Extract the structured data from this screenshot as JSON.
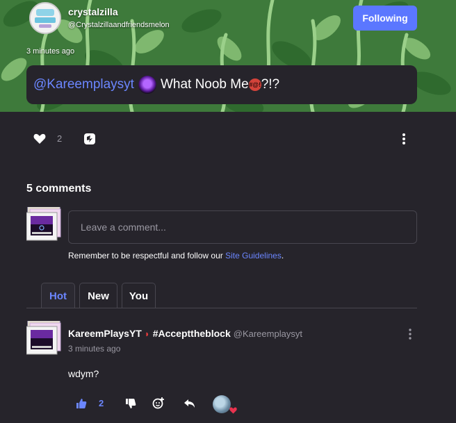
{
  "post": {
    "username": "crystalzilla",
    "handle": "@Crystalzillaandfriendsmelon",
    "time": "3 minutes ago",
    "follow_label": "Following",
    "mention": "@Kareemplaysyt",
    "message": "What Noob Me",
    "message_suffix": "?!?",
    "like_count": "2"
  },
  "comments": {
    "title": "5 comments",
    "placeholder": "Leave a comment...",
    "guidelines_prefix": "Remember to be respectful and follow our ",
    "guidelines_link": "Site Guidelines",
    "guidelines_suffix": ".",
    "tabs": [
      {
        "label": "Hot",
        "active": true
      },
      {
        "label": "New",
        "active": false
      },
      {
        "label": "You",
        "active": false
      }
    ],
    "items": [
      {
        "name": "KareemPlaysYT",
        "tag": "#Accepttheblock",
        "handle": "@Kareemplaysyt",
        "time": "3 minutes ago",
        "text": "wdym?",
        "like_count": "2"
      }
    ]
  },
  "colors": {
    "accent": "#5b77ff",
    "link": "#6b86ff",
    "background": "#26242b",
    "banner_green": "#3f7a3c"
  },
  "icons": [
    "heart-icon",
    "remix-icon",
    "more-vertical-icon",
    "thumbs-up-icon",
    "thumbs-down-icon",
    "add-reaction-icon",
    "reply-icon",
    "watermelon-icon"
  ]
}
